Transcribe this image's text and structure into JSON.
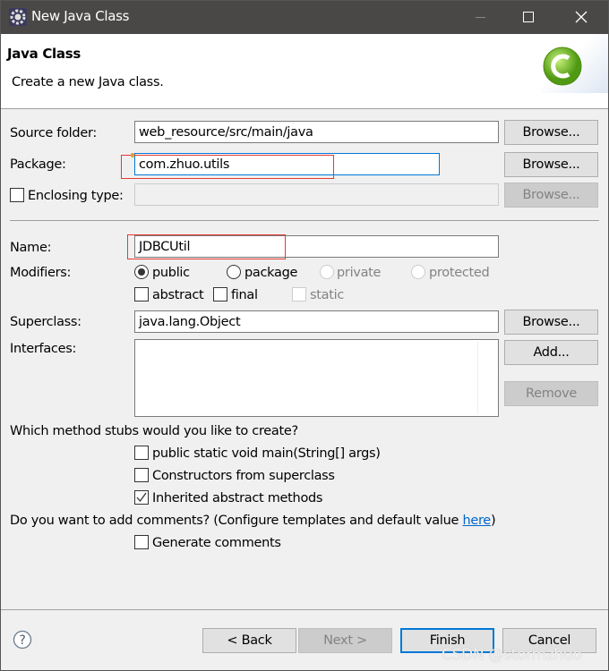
{
  "window": {
    "title": "New Java Class",
    "icon": "eclipse-gear-icon"
  },
  "header": {
    "title": "Java Class",
    "subtitle": "Create a new Java class.",
    "icon": "java-class-c-icon"
  },
  "form": {
    "source_folder": {
      "label": "Source folder:",
      "value": "web_resource/src/main/java",
      "browse": "Browse..."
    },
    "package": {
      "label": "Package:",
      "value": "com.zhuo.utils",
      "browse": "Browse..."
    },
    "enclosing": {
      "label": "Enclosing type:",
      "value": "",
      "checked": false,
      "browse": "Browse..."
    },
    "name": {
      "label": "Name:",
      "value": "JDBCUtil"
    },
    "modifiers": {
      "label": "Modifiers:",
      "radios": [
        {
          "label": "public",
          "selected": true,
          "enabled": true
        },
        {
          "label": "package",
          "selected": false,
          "enabled": true
        },
        {
          "label": "private",
          "selected": false,
          "enabled": false
        },
        {
          "label": "protected",
          "selected": false,
          "enabled": false
        }
      ],
      "checks": [
        {
          "label": "abstract",
          "checked": false,
          "enabled": true
        },
        {
          "label": "final",
          "checked": false,
          "enabled": true
        },
        {
          "label": "static",
          "checked": false,
          "enabled": false
        }
      ]
    },
    "superclass": {
      "label": "Superclass:",
      "value": "java.lang.Object",
      "browse": "Browse..."
    },
    "interfaces": {
      "label": "Interfaces:",
      "add": "Add...",
      "remove": "Remove"
    },
    "stubs": {
      "question": "Which method stubs would you like to create?",
      "items": [
        {
          "label": "public static void main(String[] args)",
          "checked": false
        },
        {
          "label": "Constructors from superclass",
          "checked": false
        },
        {
          "label": "Inherited abstract methods",
          "checked": true
        }
      ]
    },
    "comments": {
      "question": "Do you want to add comments? (Configure templates and default value ",
      "link": "here",
      "close": ")",
      "generate": "Generate comments",
      "checked": false
    }
  },
  "footer": {
    "back": "< Back",
    "next": "Next >",
    "finish": "Finish",
    "cancel": "Cancel",
    "help_icon": "help-icon"
  },
  "watermark": "CSDN @stormzhuo",
  "colors": {
    "titlebar": "#4a4846",
    "focus": "#0078d7",
    "highlight": "#e53935",
    "link": "#0066cc"
  }
}
